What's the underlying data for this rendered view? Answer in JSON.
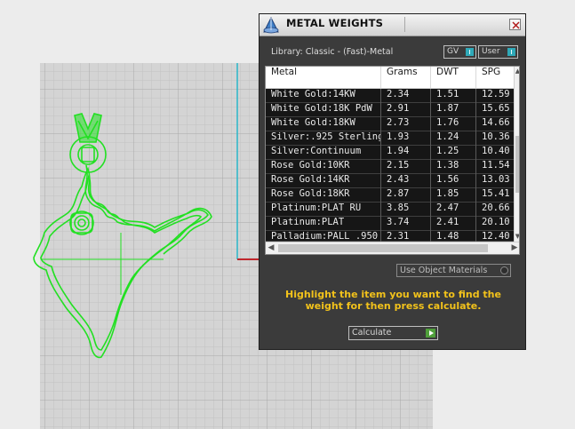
{
  "dialog": {
    "title": "METAL WEIGHTS",
    "library_label": "Library: Classic - (Fast)-Metal",
    "toggles": [
      {
        "label": "GV"
      },
      {
        "label": "User"
      }
    ],
    "columns": [
      "Metal",
      "Grams",
      "DWT",
      "SPG"
    ],
    "rows": [
      {
        "metal": "White Gold:14KW",
        "grams": "2.34",
        "dwt": "1.51",
        "spg": "12.59"
      },
      {
        "metal": "White Gold:18K PdW",
        "grams": "2.91",
        "dwt": "1.87",
        "spg": "15.65"
      },
      {
        "metal": "White Gold:18KW",
        "grams": "2.73",
        "dwt": "1.76",
        "spg": "14.66"
      },
      {
        "metal": "Silver:.925 Sterling",
        "grams": "1.93",
        "dwt": "1.24",
        "spg": "10.36"
      },
      {
        "metal": "Silver:Continuum",
        "grams": "1.94",
        "dwt": "1.25",
        "spg": "10.40"
      },
      {
        "metal": "Rose Gold:10KR",
        "grams": "2.15",
        "dwt": "1.38",
        "spg": "11.54"
      },
      {
        "metal": "Rose Gold:14KR",
        "grams": "2.43",
        "dwt": "1.56",
        "spg": "13.03"
      },
      {
        "metal": "Rose Gold:18KR",
        "grams": "2.87",
        "dwt": "1.85",
        "spg": "15.41"
      },
      {
        "metal": "Platinum:PLAT RU",
        "grams": "3.85",
        "dwt": "2.47",
        "spg": "20.66"
      },
      {
        "metal": "Platinum:PLAT",
        "grams": "3.74",
        "dwt": "2.41",
        "spg": "20.10"
      },
      {
        "metal": "Palladium:PALL .950",
        "grams": "2.31",
        "dwt": "1.48",
        "spg": "12.40"
      }
    ],
    "use_object_materials_label": "Use Object Materials",
    "instruction": "Highlight the item you want to find the weight for then press calculate.",
    "calculate_label": "Calculate"
  },
  "colors": {
    "panel_bg": "#3b3b3b",
    "instruction_text": "#f2c21b",
    "curve_green": "#22e022",
    "toggle_accent": "#2fa9b8",
    "calculate_accent": "#4f9f3a"
  }
}
